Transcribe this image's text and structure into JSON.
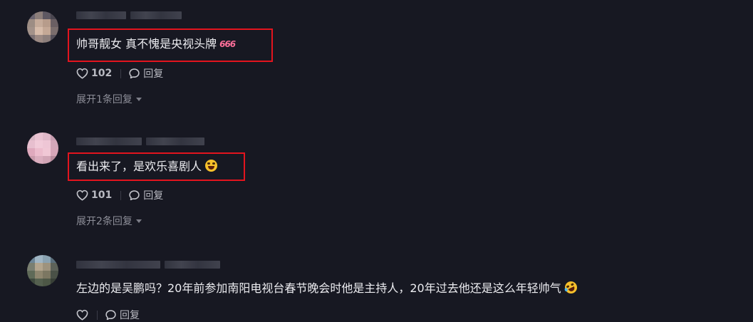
{
  "comments": [
    {
      "text": "帅哥靓女 真不愧是央视头牌",
      "emoji": "666",
      "likes": "102",
      "reply_label": "回复",
      "expand_label": "展开1条回复"
    },
    {
      "text": "看出来了，是欢乐喜剧人",
      "emoji": "laughing-face-emoji",
      "likes": "101",
      "reply_label": "回复",
      "expand_label": "展开2条回复"
    },
    {
      "text": "左边的是吴鹏吗？20年前参加南阳电视台春节晚会时他是主持人，20年过去他还是这么年轻帅气",
      "emoji": "rolling-laughing-emoji",
      "likes": "",
      "reply_label": "回复",
      "expand_label": ""
    }
  ],
  "colors": {
    "background": "#171822",
    "highlight_border": "#e3141e",
    "text": "#ececf0",
    "secondary": "#b9bac2"
  }
}
